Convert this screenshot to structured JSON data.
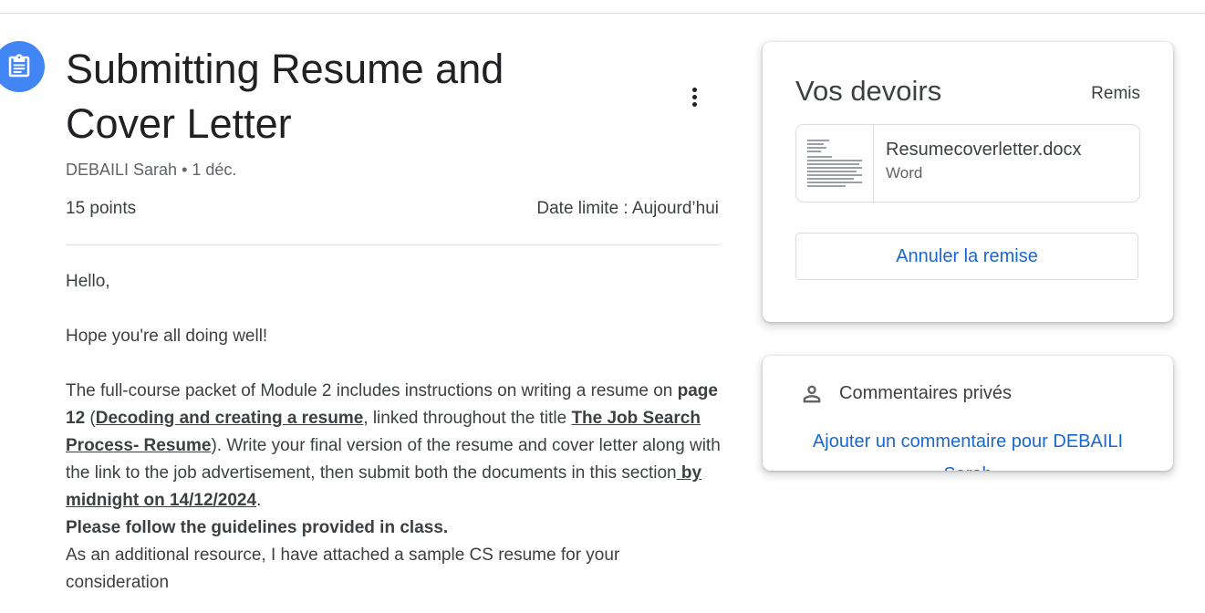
{
  "assignment": {
    "title": "Submitting Resume and Cover Letter",
    "meta": "DEBAILI Sarah • 1 déc.",
    "points": "15 points",
    "due": "Date limite : Aujourd’hui"
  },
  "description": {
    "p1": "Hello,",
    "p2": "Hope you're all doing well!",
    "p3_a": "The full-course packet of Module 2 includes instructions on writing a resume on ",
    "p3_b": "page 12",
    "p3_c": " (",
    "p3_d": "Decoding and creating a resume",
    "p3_e": ", linked throughout the title ",
    "p3_f": "The Job Search Process- Resume",
    "p3_g": "). Write your final version of the resume and cover letter along with the link to the job advertisement, then submit both the documents in this section",
    "p3_h": " by midnight on 14/12/2024",
    "p3_i": ".",
    "p4": "Please follow the guidelines provided in class.",
    "p5": "As an additional resource, I have attached a sample CS resume for your consideration"
  },
  "your_work": {
    "title": "Vos devoirs",
    "status": "Remis",
    "attachment": {
      "name": "Resumecoverletter.docx",
      "type": "Word"
    },
    "unsubmit_label": "Annuler la remise"
  },
  "private_comments": {
    "title": "Commentaires privés",
    "add_link": "Ajouter un commentaire pour DEBAILI Sarah"
  },
  "colors": {
    "accent": "#1967d2",
    "icon_bg": "#4285f4"
  },
  "icons": [
    "assignment-icon",
    "more-vert-icon",
    "document-thumbnail",
    "person-icon"
  ]
}
